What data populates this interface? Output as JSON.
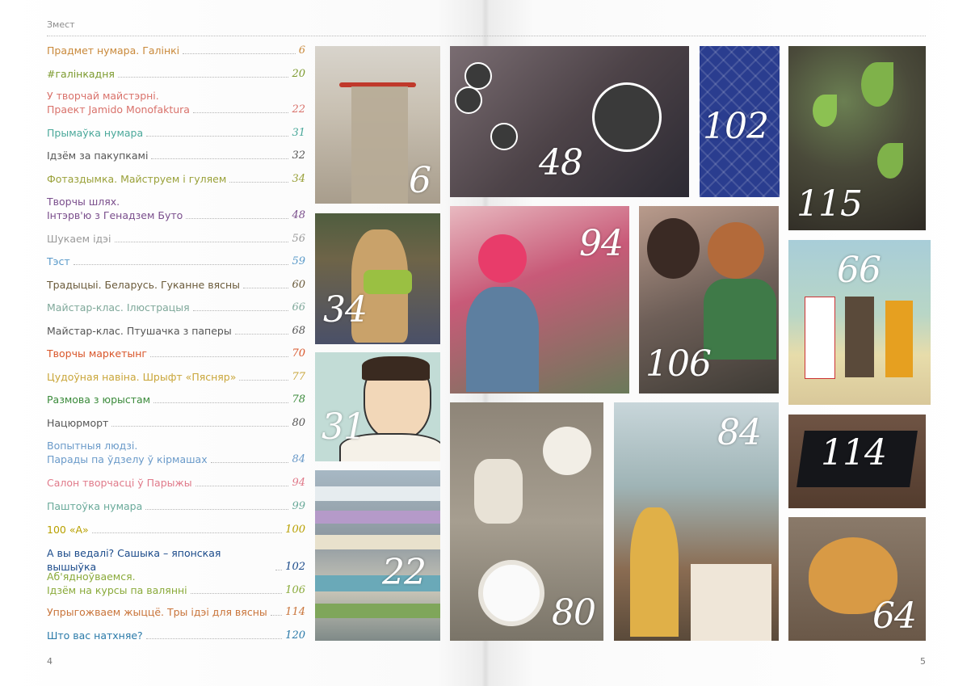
{
  "header": {
    "section_title": "Змест"
  },
  "toc": [
    {
      "label": "Прадмет нумара. Галінкі",
      "page": "6",
      "color": "#c9893a"
    },
    {
      "label": "#галінкадня",
      "page": "20",
      "color": "#7c9a2e"
    },
    {
      "label": "У творчай майстэрні.\nПраект Jamido Monofaktura",
      "page": "22",
      "color": "#d9726b"
    },
    {
      "label": "Прымаўка нумара",
      "page": "31",
      "color": "#4aa89a"
    },
    {
      "label": "Ідзём за пакупкамі",
      "page": "32",
      "color": "#555555"
    },
    {
      "label": "Фотаздымка. Майструем і гуляем",
      "page": "34",
      "color": "#9aa13a"
    },
    {
      "label": "Творчы шлях.\nІнтэрв'ю з Генадзем Буто",
      "page": "48",
      "color": "#7a4e8c"
    },
    {
      "label": "Шукаем ідэі",
      "page": "56",
      "color": "#9a9a9a"
    },
    {
      "label": "Тэст",
      "page": "59",
      "color": "#5a9ac9"
    },
    {
      "label": "Традыцыі. Беларусь. Гуканне вясны",
      "page": "60",
      "color": "#6a5a3a"
    },
    {
      "label": "Майстар-клас. Ілюстрацыя",
      "page": "66",
      "color": "#7fa89a"
    },
    {
      "label": "Майстар-клас. Птушачка з паперы",
      "page": "68",
      "color": "#555555"
    },
    {
      "label": "Творчы маркетынг",
      "page": "70",
      "color": "#d9562a"
    },
    {
      "label": "Цудоўная навіна. Шрыфт «Пясняр»",
      "page": "77",
      "color": "#c9a63a"
    },
    {
      "label": "Размова з юрыстам",
      "page": "78",
      "color": "#3a8a3a"
    },
    {
      "label": "Нацюрморт",
      "page": "80",
      "color": "#555555"
    },
    {
      "label": "Вопытныя людзі.\nПарады па ўдзелу ў кірмашах",
      "page": "84",
      "color": "#6a9ac9"
    },
    {
      "label": "Салон творчасці ў Парыжы",
      "page": "94",
      "color": "#e07a8a"
    },
    {
      "label": "Паштоўка нумара",
      "page": "99",
      "color": "#6aaa9a"
    },
    {
      "label": "100 «А»",
      "page": "100",
      "color": "#b8a000"
    },
    {
      "label": "А вы ведалі? Сашыка – японская вышыўка",
      "page": "102",
      "color": "#1a4a8a"
    },
    {
      "label": "Аб'ядноўваемся.\nІдзём на курсы па валянні",
      "page": "106",
      "color": "#8aaa3a"
    },
    {
      "label": "Упрыгожваем жыццё. Тры ідэі для вясны",
      "page": "114",
      "color": "#c9743a"
    },
    {
      "label": "Што вас натхняе?",
      "page": "120",
      "color": "#2a7aa9"
    }
  ],
  "photos": [
    {
      "page": "6"
    },
    {
      "page": "48"
    },
    {
      "page": "102"
    },
    {
      "page": "115"
    },
    {
      "page": "34"
    },
    {
      "page": "94"
    },
    {
      "page": "106"
    },
    {
      "page": "66"
    },
    {
      "page": "31"
    },
    {
      "page": "114"
    },
    {
      "page": "80"
    },
    {
      "page": "84"
    },
    {
      "page": "22"
    },
    {
      "page": "64"
    }
  ],
  "folio": {
    "left": "4",
    "right": "5"
  }
}
